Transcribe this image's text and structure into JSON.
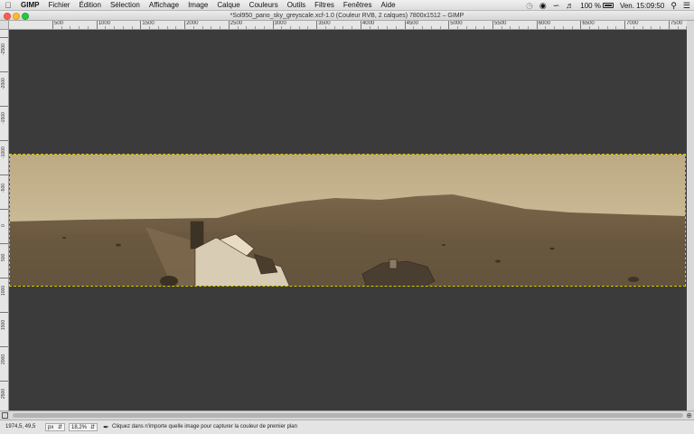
{
  "menubar": {
    "apple_icon": "apple-logo-icon",
    "items": [
      "GIMP",
      "Fichier",
      "Édition",
      "Sélection",
      "Affichage",
      "Image",
      "Calque",
      "Couleurs",
      "Outils",
      "Filtres",
      "Fenêtres",
      "Aide"
    ],
    "battery_percent": "100 %",
    "clock": "Ven. 15:09:50"
  },
  "window": {
    "title": "*Sol950_pano_sky_greyscale.xcf-1.0 (Couleur RVB, 2 calques) 7800x1512 – GIMP"
  },
  "rulers": {
    "horizontal_labels": [
      "500",
      "1000",
      "1500",
      "2000",
      "2500",
      "3000",
      "3500",
      "4000",
      "4500",
      "5000",
      "5500",
      "6000",
      "6500",
      "7000",
      "7500"
    ],
    "vertical_labels": [
      "-2500",
      "-2000",
      "-1500",
      "-1000",
      "-500",
      "0",
      "500",
      "1000",
      "1500",
      "2000",
      "2500"
    ]
  },
  "statusbar": {
    "coordinates": "1974,5, 49,5",
    "unit": "px",
    "zoom": "18,2%",
    "message": "Cliquez dans n'importe quelle image pour capturer la couleur de premier plan"
  },
  "colors": {
    "canvas_bg": "#3b3b3b",
    "selection_outline": "#d9c600",
    "sky": "#c9b993",
    "ground": "#6e5c44"
  }
}
